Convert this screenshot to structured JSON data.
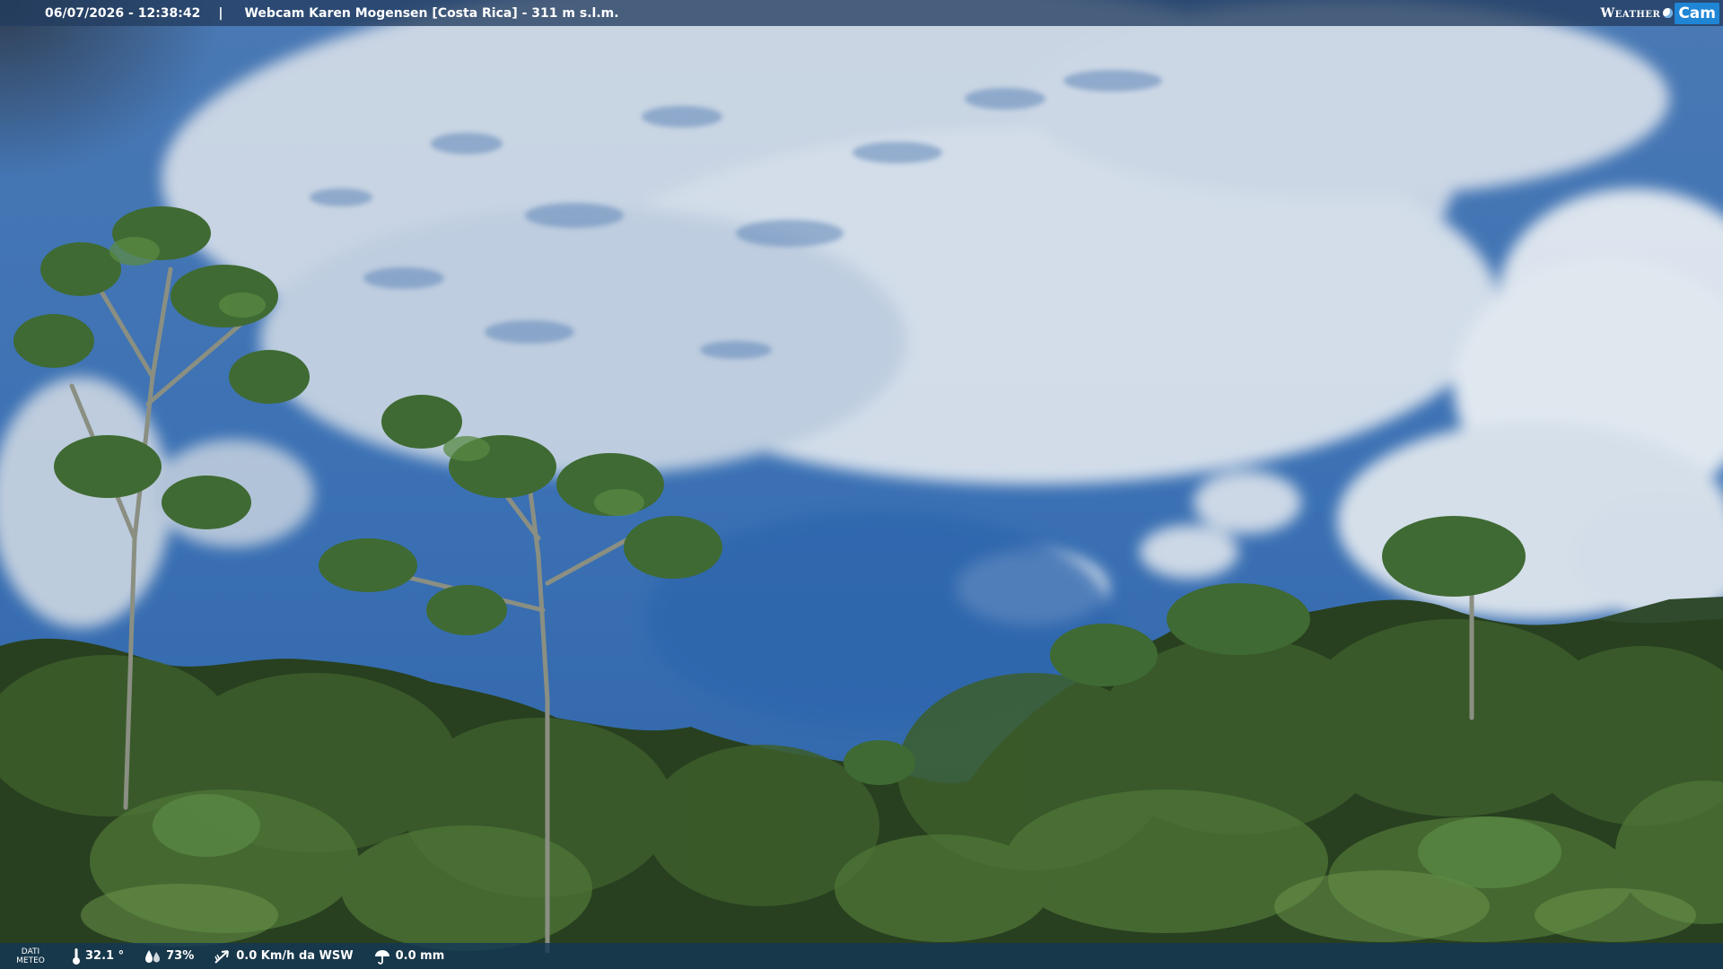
{
  "header": {
    "datetime": "06/07/2026 - 12:38:42",
    "separator": "|",
    "title": "Webcam Karen Mogensen [Costa Rica] - 311 m s.l.m."
  },
  "logo": {
    "weather": "Weather",
    "cam": "Cam"
  },
  "weather_bar": {
    "label": "DATI METEO",
    "temperature": "32.1 °",
    "humidity": "73%",
    "wind": "0.0 Km/h da WSW",
    "rain": "0.0 mm"
  },
  "colors": {
    "sky": "#3a70b5",
    "bar": "#1e3a5c",
    "cam_badge": "#1f86d6"
  }
}
